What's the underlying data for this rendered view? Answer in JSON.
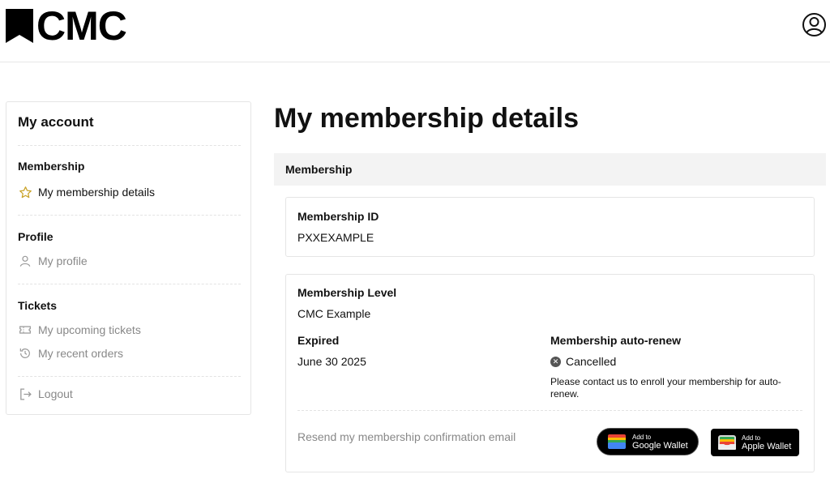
{
  "header": {
    "logo_text": "CMC",
    "account_icon": "user-circle-icon"
  },
  "sidebar": {
    "title": "My account",
    "sections": [
      {
        "heading": "Membership",
        "items": [
          {
            "label": "My membership details",
            "icon": "star-icon",
            "active": true
          }
        ]
      },
      {
        "heading": "Profile",
        "items": [
          {
            "label": "My profile",
            "icon": "person-icon"
          }
        ]
      },
      {
        "heading": "Tickets",
        "items": [
          {
            "label": "My upcoming tickets",
            "icon": "ticket-icon"
          },
          {
            "label": "My recent orders",
            "icon": "history-icon"
          }
        ]
      }
    ],
    "logout_label": "Logout",
    "logout_icon": "logout-icon",
    "star_color": "#c9a227"
  },
  "main": {
    "title": "My membership details",
    "section_label": "Membership",
    "membership_id": {
      "label": "Membership ID",
      "value": "PXXEXAMPLE"
    },
    "membership_level": {
      "label": "Membership Level",
      "value": "CMC Example"
    },
    "expired": {
      "label": "Expired",
      "value": "June 30 2025"
    },
    "auto_renew": {
      "label": "Membership auto-renew",
      "status": "Cancelled",
      "note": "Please contact us to enroll your membership for auto-renew."
    },
    "resend_label": "Resend my membership confirmation email",
    "google_wallet": {
      "small": "Add to",
      "big": "Google Wallet"
    },
    "apple_wallet": {
      "small": "Add to",
      "big": "Apple Wallet"
    }
  }
}
